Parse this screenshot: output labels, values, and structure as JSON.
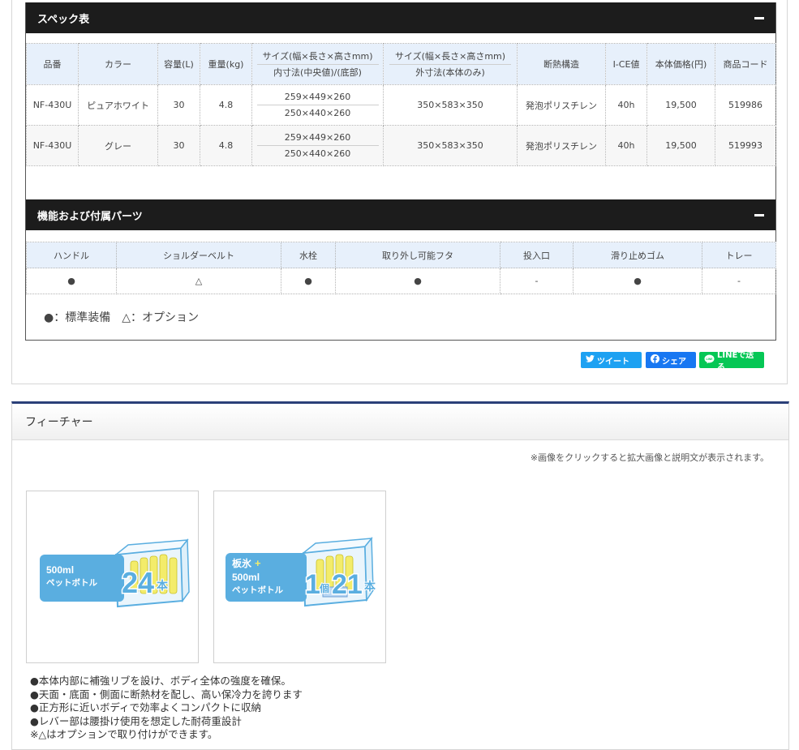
{
  "spec": {
    "title": "スペック表",
    "headers": [
      "品番",
      "カラー",
      "容量(L)",
      "重量(kg)",
      [
        "サイズ(幅×長さ×高さmm)",
        "内寸法(中央値)/(底部)"
      ],
      [
        "サイズ(幅×長さ×高さmm)",
        "外寸法(本体のみ)"
      ],
      "断熱構造",
      "I-CE値",
      "本体価格(円)",
      "商品コード"
    ],
    "rows": [
      {
        "model": "NF-430U",
        "color": "ピュアホワイト",
        "capacity": "30",
        "weight": "4.8",
        "inner1": "259×449×260",
        "inner2": "250×440×260",
        "outer": "350×583×350",
        "insulation": "発泡ポリスチレン",
        "ice": "40h",
        "price": "19,500",
        "code": "519986"
      },
      {
        "model": "NF-430U",
        "color": "グレー",
        "capacity": "30",
        "weight": "4.8",
        "inner1": "259×449×260",
        "inner2": "250×440×260",
        "outer": "350×583×350",
        "insulation": "発泡ポリスチレン",
        "ice": "40h",
        "price": "19,500",
        "code": "519993"
      }
    ]
  },
  "parts": {
    "title": "機能および付属パーツ",
    "headers": [
      "ハンドル",
      "ショルダーベルト",
      "水栓",
      "取り外し可能フタ",
      "投入口",
      "滑り止めゴム",
      "トレー"
    ],
    "values": [
      "●",
      "△",
      "●",
      "●",
      "-",
      "●",
      "-"
    ],
    "legend": "●：標準装備　△：オプション"
  },
  "share": {
    "tweet": "ツイート",
    "facebook": "シェア",
    "line": "LINEで送る",
    "colors": {
      "twitter": "#1da1f2",
      "facebook": "#1877f2",
      "line": "#06c755"
    }
  },
  "feature": {
    "title": "フィーチャー",
    "note": "※画像をクリックすると拡大画像と説明文が表示されます。",
    "images": [
      {
        "label1": "500ml",
        "label2": "ペットボトル",
        "count": "24",
        "unit": "本"
      },
      {
        "label0": "板氷",
        "plus": "+",
        "label1": "500ml",
        "label2": "ペットボトル",
        "count_a": "1",
        "unit_a": "個",
        "count_b": "21",
        "unit_b": "本"
      }
    ],
    "items": [
      "●本体内部に補強リブを設け、ボディ全体の強度を確保。",
      "●天面・底面・側面に断熱材を配し、高い保冷力を誇ります",
      "●正方形に近いボディで効率よくコンパクトに収納",
      "●レバー部は腰掛け使用を想定した耐荷重設計",
      "※△はオプションで取り付けができます。"
    ],
    "accent_blue": "#5aaee0"
  }
}
